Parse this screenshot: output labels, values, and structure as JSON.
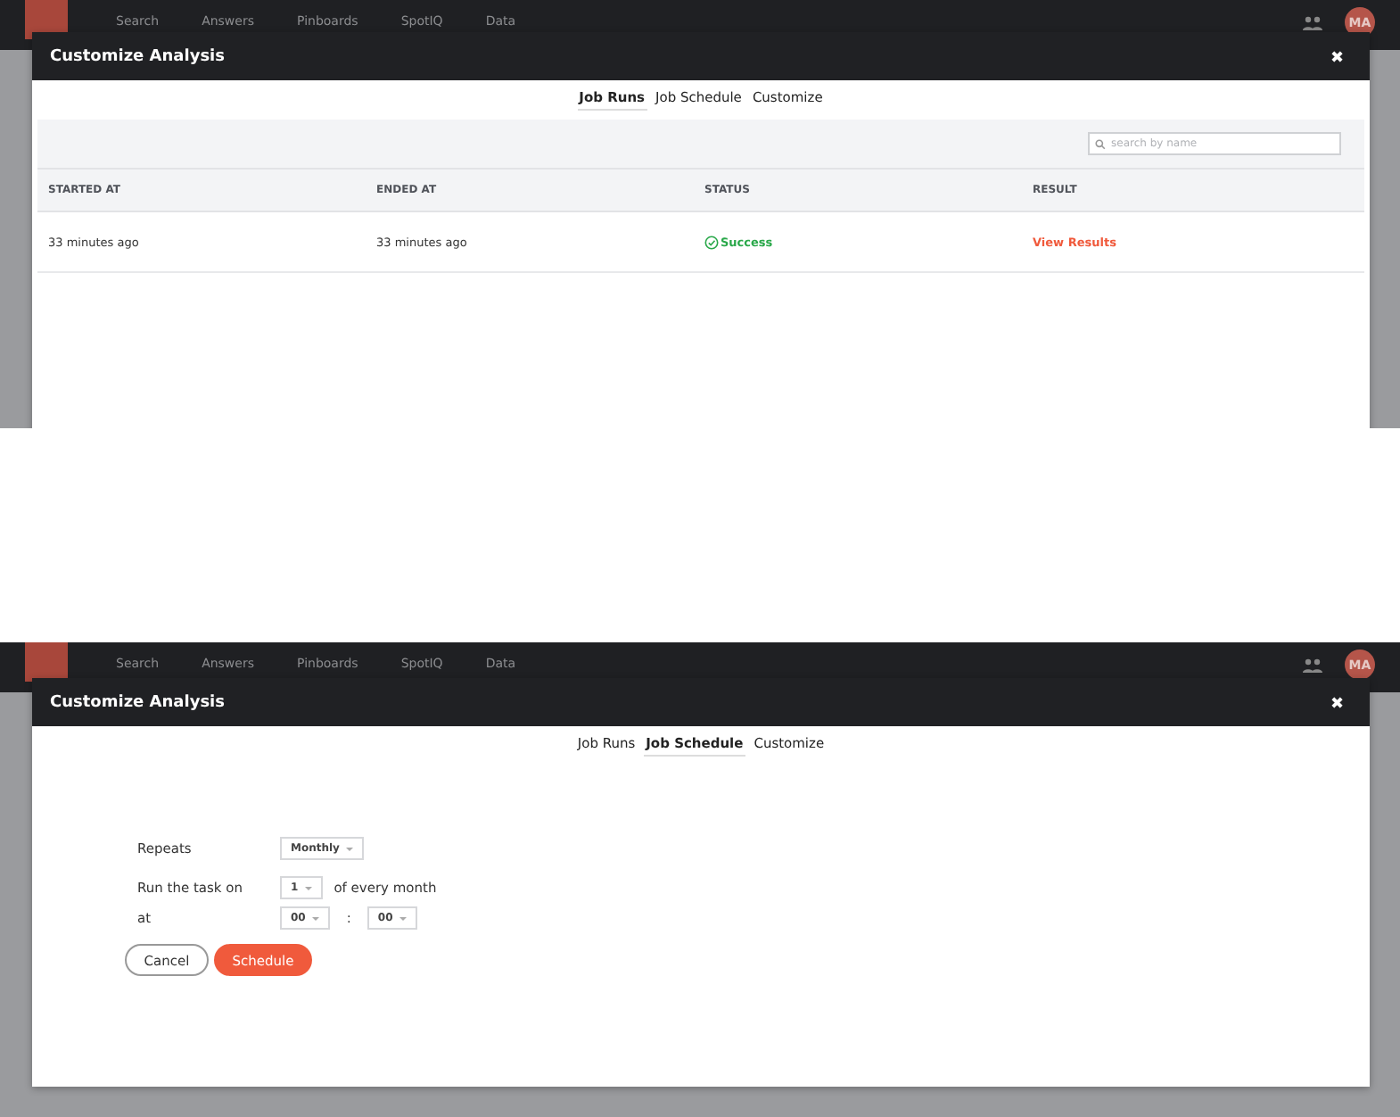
{
  "screens": [
    {
      "kind": "job_runs",
      "nav": {
        "items": [
          "Search",
          "Answers",
          "Pinboards",
          "SpotIQ",
          "Data"
        ],
        "avatar": "MA"
      },
      "modal": {
        "title": "Customize Analysis",
        "close": "✖",
        "tabs": [
          {
            "label": "Job Runs",
            "selected": true
          },
          {
            "label": "Job Schedule",
            "selected": false
          },
          {
            "label": "Customize",
            "selected": false
          }
        ],
        "search": {
          "placeholder": "search by name"
        },
        "columns": [
          "STARTED AT",
          "ENDED AT",
          "STATUS",
          "RESULT"
        ],
        "rows": [
          {
            "started": "33 minutes ago",
            "ended": "33 minutes ago",
            "status": "Success",
            "result": "View Results"
          }
        ]
      }
    },
    {
      "kind": "job_schedule",
      "nav": {
        "items": [
          "Search",
          "Answers",
          "Pinboards",
          "SpotIQ",
          "Data"
        ],
        "avatar": "MA"
      },
      "modal": {
        "title": "Customize Analysis",
        "close": "✖",
        "tabs": [
          {
            "label": "Job Runs",
            "selected": false
          },
          {
            "label": "Job Schedule",
            "selected": true
          },
          {
            "label": "Customize",
            "selected": false
          }
        ],
        "repeats": {
          "label": "Repeats",
          "value": "Monthly"
        },
        "run_on": {
          "label": "Run the task on",
          "value": "1",
          "suffix": "of every month"
        },
        "at": {
          "label": "at",
          "hour": "00",
          "separator": ":",
          "minute": "00"
        },
        "buttons": {
          "cancel": "Cancel",
          "schedule": "Schedule"
        }
      }
    }
  ]
}
